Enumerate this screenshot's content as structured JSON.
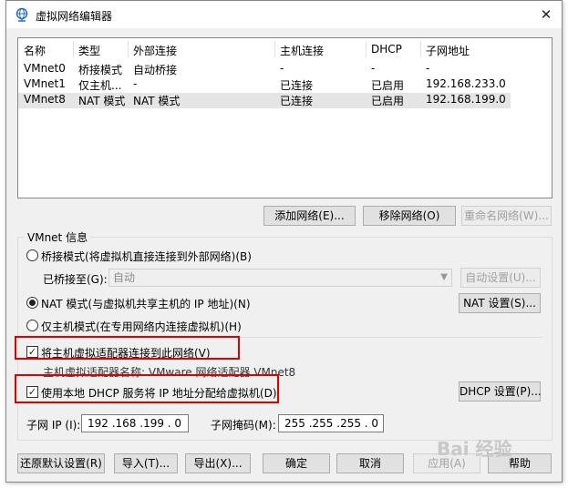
{
  "window": {
    "title": "虚拟网络编辑器",
    "close_glyph": "✕"
  },
  "network_list": {
    "headers": [
      "名称",
      "类型",
      "外部连接",
      "主机连接",
      "DHCP",
      "子网地址"
    ],
    "rows": [
      [
        "VMnet0",
        "桥接模式",
        "自动桥接",
        "-",
        "-",
        "-"
      ],
      [
        "VMnet1",
        "仅主机...",
        "-",
        "已连接",
        "已启用",
        "192.168.233.0"
      ],
      [
        "VMnet8",
        "NAT 模式",
        "NAT 模式",
        "已连接",
        "已启用",
        "192.168.199.0"
      ]
    ],
    "selected_index": 2
  },
  "list_buttons": {
    "add": "添加网络(E)...",
    "remove": "移除网络(O)",
    "rename": "重命名网络(W)..."
  },
  "vmnet_info": {
    "title": "VMnet 信息",
    "bridged": {
      "label": "桥接模式(将虚拟机直接连接到外部网络)(B)",
      "checked": false
    },
    "bridged_to": {
      "label": "已桥接至(G):",
      "value": "自动",
      "auto_button": "自动设置(U)..."
    },
    "nat": {
      "label": "NAT 模式(与虚拟机共享主机的 IP 地址)(N)",
      "checked": true,
      "settings_button": "NAT 设置(S)..."
    },
    "host_only": {
      "label": "仅主机模式(在专用网络内连接虚拟机)(H)",
      "checked": false
    },
    "connect_adapter": {
      "label": "将主机虚拟适配器连接到此网络(V)",
      "checked": true
    },
    "adapter_name": "主机虚拟适配器名称: VMware 网络适配器 VMnet8",
    "use_dhcp": {
      "label": "使用本地 DHCP 服务将 IP 地址分配给虚拟机(D)",
      "checked": true,
      "settings_button": "DHCP 设置(P)..."
    },
    "subnet_ip": {
      "label": "子网 IP (I):",
      "value": "192 .168 .199 . 0"
    },
    "subnet_mask": {
      "label": "子网掩码(M):",
      "value": "255 .255 .255 . 0"
    }
  },
  "footer": {
    "restore": "还原默认设置(R)",
    "import": "导入(T)...",
    "export": "导出(X)...",
    "ok": "确定",
    "cancel": "取消",
    "apply": "应用(A)",
    "help": "帮助"
  },
  "icons": {
    "app": "network-globe-icon",
    "check": "✓"
  },
  "colors": {
    "highlight_box": "#e00000",
    "selected_row": "#e5e5e5"
  },
  "watermark": "Bai 经验"
}
